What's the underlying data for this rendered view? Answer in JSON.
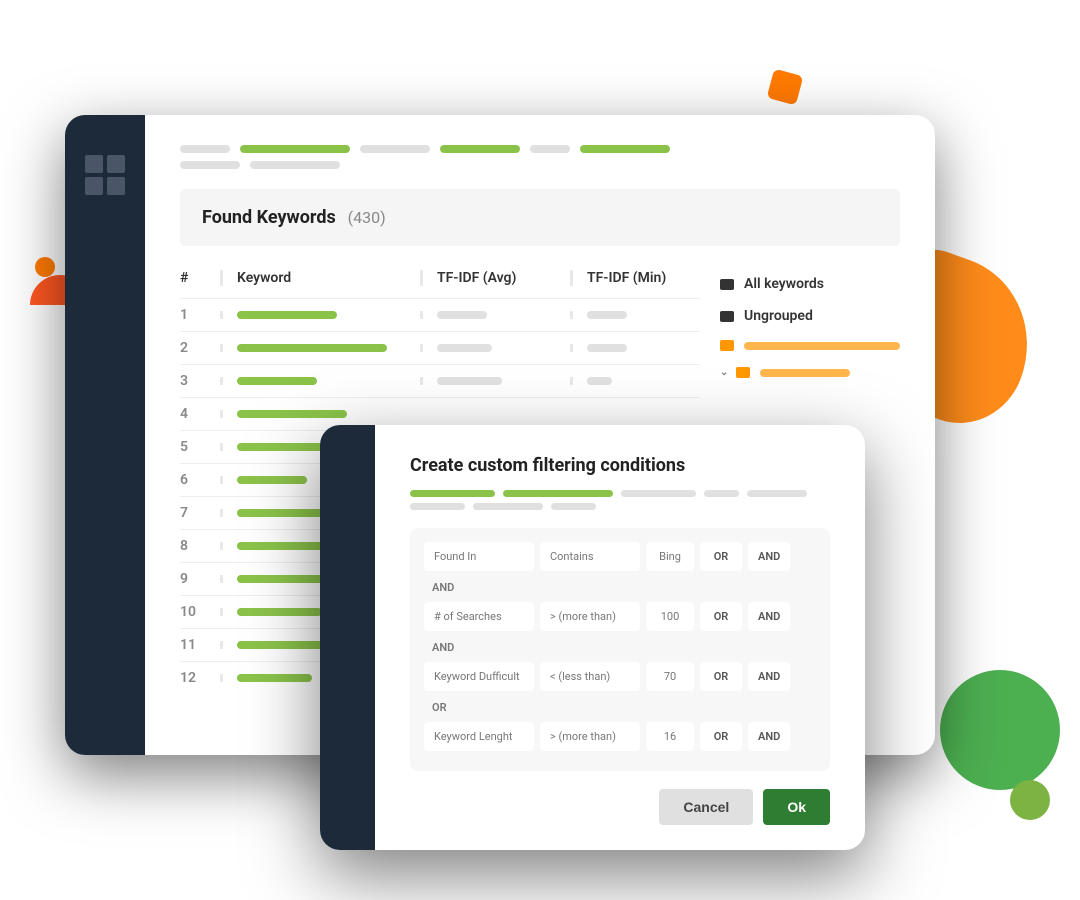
{
  "section": {
    "title": "Found Keywords",
    "count": "(430)"
  },
  "table": {
    "headers": {
      "num": "#",
      "keyword": "Keyword",
      "avg": "TF-IDF (Avg)",
      "min": "TF-IDF (Min)"
    },
    "rows": [
      {
        "n": "1",
        "kw": 100,
        "avg": 50,
        "min": 40
      },
      {
        "n": "2",
        "kw": 150,
        "avg": 55,
        "min": 40
      },
      {
        "n": "3",
        "kw": 80,
        "avg": 65,
        "min": 25
      },
      {
        "n": "4",
        "kw": 110,
        "avg": 0,
        "min": 0
      },
      {
        "n": "5",
        "kw": 95,
        "avg": 0,
        "min": 0
      },
      {
        "n": "6",
        "kw": 70,
        "avg": 0,
        "min": 0
      },
      {
        "n": "7",
        "kw": 120,
        "avg": 0,
        "min": 0
      },
      {
        "n": "8",
        "kw": 90,
        "avg": 0,
        "min": 0
      },
      {
        "n": "9",
        "kw": 105,
        "avg": 0,
        "min": 0
      },
      {
        "n": "10",
        "kw": 85,
        "avg": 0,
        "min": 0
      },
      {
        "n": "11",
        "kw": 115,
        "avg": 0,
        "min": 0
      },
      {
        "n": "12",
        "kw": 75,
        "avg": 0,
        "min": 0
      }
    ]
  },
  "folders": {
    "all": "All keywords",
    "ungrouped": "Ungrouped"
  },
  "modal": {
    "title": "Create custom filtering conditions",
    "rows": [
      {
        "field": "Found In",
        "op": "Contains",
        "val": "Bing",
        "or": "OR",
        "and": "AND",
        "joinAfter": "AND"
      },
      {
        "field": "# of Searches",
        "op": "> (more than)",
        "val": "100",
        "or": "OR",
        "and": "AND",
        "joinAfter": "AND"
      },
      {
        "field": "Keyword Dufficult",
        "op": "< (less than)",
        "val": "70",
        "or": "OR",
        "and": "AND",
        "joinAfter": "OR"
      },
      {
        "field": "Keyword Lenght",
        "op": "> (more than)",
        "val": "16",
        "or": "OR",
        "and": "AND",
        "joinAfter": ""
      }
    ],
    "cancel": "Cancel",
    "ok": "Ok"
  }
}
